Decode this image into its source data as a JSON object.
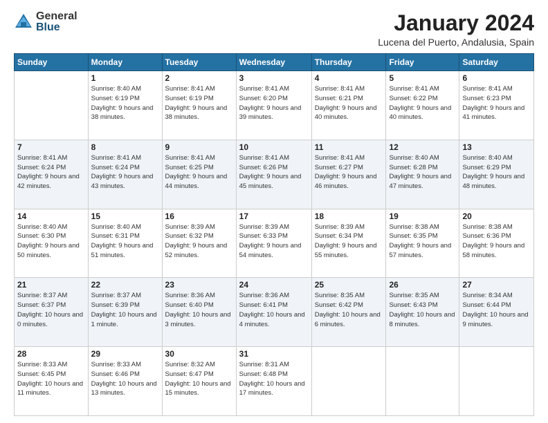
{
  "logo": {
    "general": "General",
    "blue": "Blue"
  },
  "title": "January 2024",
  "location": "Lucena del Puerto, Andalusia, Spain",
  "days_header": [
    "Sunday",
    "Monday",
    "Tuesday",
    "Wednesday",
    "Thursday",
    "Friday",
    "Saturday"
  ],
  "weeks": [
    [
      {
        "day": "",
        "sunrise": "",
        "sunset": "",
        "daylight": ""
      },
      {
        "day": "1",
        "sunrise": "Sunrise: 8:40 AM",
        "sunset": "Sunset: 6:19 PM",
        "daylight": "Daylight: 9 hours and 38 minutes."
      },
      {
        "day": "2",
        "sunrise": "Sunrise: 8:41 AM",
        "sunset": "Sunset: 6:19 PM",
        "daylight": "Daylight: 9 hours and 38 minutes."
      },
      {
        "day": "3",
        "sunrise": "Sunrise: 8:41 AM",
        "sunset": "Sunset: 6:20 PM",
        "daylight": "Daylight: 9 hours and 39 minutes."
      },
      {
        "day": "4",
        "sunrise": "Sunrise: 8:41 AM",
        "sunset": "Sunset: 6:21 PM",
        "daylight": "Daylight: 9 hours and 40 minutes."
      },
      {
        "day": "5",
        "sunrise": "Sunrise: 8:41 AM",
        "sunset": "Sunset: 6:22 PM",
        "daylight": "Daylight: 9 hours and 40 minutes."
      },
      {
        "day": "6",
        "sunrise": "Sunrise: 8:41 AM",
        "sunset": "Sunset: 6:23 PM",
        "daylight": "Daylight: 9 hours and 41 minutes."
      }
    ],
    [
      {
        "day": "7",
        "sunrise": "Sunrise: 8:41 AM",
        "sunset": "Sunset: 6:24 PM",
        "daylight": "Daylight: 9 hours and 42 minutes."
      },
      {
        "day": "8",
        "sunrise": "Sunrise: 8:41 AM",
        "sunset": "Sunset: 6:24 PM",
        "daylight": "Daylight: 9 hours and 43 minutes."
      },
      {
        "day": "9",
        "sunrise": "Sunrise: 8:41 AM",
        "sunset": "Sunset: 6:25 PM",
        "daylight": "Daylight: 9 hours and 44 minutes."
      },
      {
        "day": "10",
        "sunrise": "Sunrise: 8:41 AM",
        "sunset": "Sunset: 6:26 PM",
        "daylight": "Daylight: 9 hours and 45 minutes."
      },
      {
        "day": "11",
        "sunrise": "Sunrise: 8:41 AM",
        "sunset": "Sunset: 6:27 PM",
        "daylight": "Daylight: 9 hours and 46 minutes."
      },
      {
        "day": "12",
        "sunrise": "Sunrise: 8:40 AM",
        "sunset": "Sunset: 6:28 PM",
        "daylight": "Daylight: 9 hours and 47 minutes."
      },
      {
        "day": "13",
        "sunrise": "Sunrise: 8:40 AM",
        "sunset": "Sunset: 6:29 PM",
        "daylight": "Daylight: 9 hours and 48 minutes."
      }
    ],
    [
      {
        "day": "14",
        "sunrise": "Sunrise: 8:40 AM",
        "sunset": "Sunset: 6:30 PM",
        "daylight": "Daylight: 9 hours and 50 minutes."
      },
      {
        "day": "15",
        "sunrise": "Sunrise: 8:40 AM",
        "sunset": "Sunset: 6:31 PM",
        "daylight": "Daylight: 9 hours and 51 minutes."
      },
      {
        "day": "16",
        "sunrise": "Sunrise: 8:39 AM",
        "sunset": "Sunset: 6:32 PM",
        "daylight": "Daylight: 9 hours and 52 minutes."
      },
      {
        "day": "17",
        "sunrise": "Sunrise: 8:39 AM",
        "sunset": "Sunset: 6:33 PM",
        "daylight": "Daylight: 9 hours and 54 minutes."
      },
      {
        "day": "18",
        "sunrise": "Sunrise: 8:39 AM",
        "sunset": "Sunset: 6:34 PM",
        "daylight": "Daylight: 9 hours and 55 minutes."
      },
      {
        "day": "19",
        "sunrise": "Sunrise: 8:38 AM",
        "sunset": "Sunset: 6:35 PM",
        "daylight": "Daylight: 9 hours and 57 minutes."
      },
      {
        "day": "20",
        "sunrise": "Sunrise: 8:38 AM",
        "sunset": "Sunset: 6:36 PM",
        "daylight": "Daylight: 9 hours and 58 minutes."
      }
    ],
    [
      {
        "day": "21",
        "sunrise": "Sunrise: 8:37 AM",
        "sunset": "Sunset: 6:37 PM",
        "daylight": "Daylight: 10 hours and 0 minutes."
      },
      {
        "day": "22",
        "sunrise": "Sunrise: 8:37 AM",
        "sunset": "Sunset: 6:39 PM",
        "daylight": "Daylight: 10 hours and 1 minute."
      },
      {
        "day": "23",
        "sunrise": "Sunrise: 8:36 AM",
        "sunset": "Sunset: 6:40 PM",
        "daylight": "Daylight: 10 hours and 3 minutes."
      },
      {
        "day": "24",
        "sunrise": "Sunrise: 8:36 AM",
        "sunset": "Sunset: 6:41 PM",
        "daylight": "Daylight: 10 hours and 4 minutes."
      },
      {
        "day": "25",
        "sunrise": "Sunrise: 8:35 AM",
        "sunset": "Sunset: 6:42 PM",
        "daylight": "Daylight: 10 hours and 6 minutes."
      },
      {
        "day": "26",
        "sunrise": "Sunrise: 8:35 AM",
        "sunset": "Sunset: 6:43 PM",
        "daylight": "Daylight: 10 hours and 8 minutes."
      },
      {
        "day": "27",
        "sunrise": "Sunrise: 8:34 AM",
        "sunset": "Sunset: 6:44 PM",
        "daylight": "Daylight: 10 hours and 9 minutes."
      }
    ],
    [
      {
        "day": "28",
        "sunrise": "Sunrise: 8:33 AM",
        "sunset": "Sunset: 6:45 PM",
        "daylight": "Daylight: 10 hours and 11 minutes."
      },
      {
        "day": "29",
        "sunrise": "Sunrise: 8:33 AM",
        "sunset": "Sunset: 6:46 PM",
        "daylight": "Daylight: 10 hours and 13 minutes."
      },
      {
        "day": "30",
        "sunrise": "Sunrise: 8:32 AM",
        "sunset": "Sunset: 6:47 PM",
        "daylight": "Daylight: 10 hours and 15 minutes."
      },
      {
        "day": "31",
        "sunrise": "Sunrise: 8:31 AM",
        "sunset": "Sunset: 6:48 PM",
        "daylight": "Daylight: 10 hours and 17 minutes."
      },
      {
        "day": "",
        "sunrise": "",
        "sunset": "",
        "daylight": ""
      },
      {
        "day": "",
        "sunrise": "",
        "sunset": "",
        "daylight": ""
      },
      {
        "day": "",
        "sunrise": "",
        "sunset": "",
        "daylight": ""
      }
    ]
  ]
}
